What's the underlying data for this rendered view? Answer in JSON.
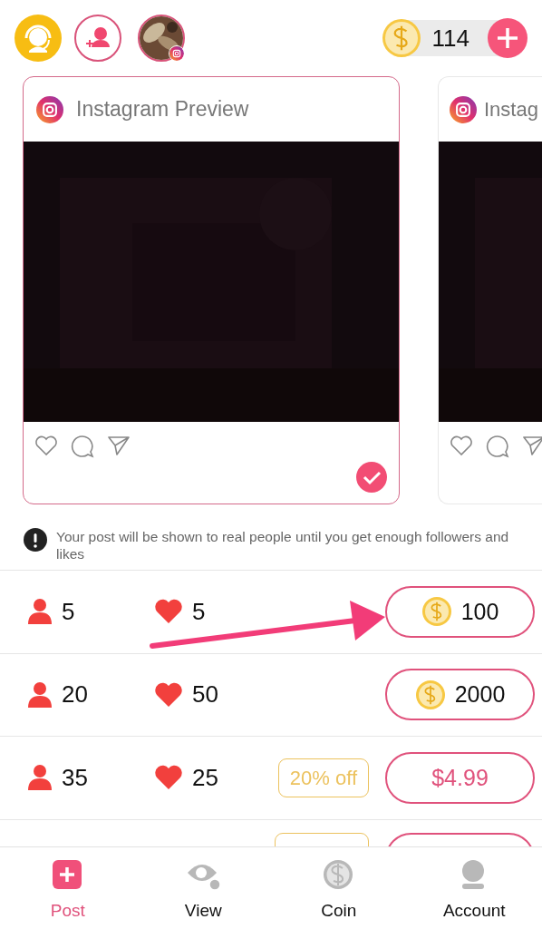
{
  "top_bar": {
    "coins": "114"
  },
  "previews": [
    {
      "title": "Instagram Preview",
      "selected": true
    },
    {
      "title": "Instag",
      "selected": false
    }
  ],
  "notice": "Your post will be shown to real people until you get enough followers and likes",
  "packages": [
    {
      "kind": "full",
      "followers": "5",
      "likes": "5",
      "price": {
        "kind": "coin",
        "text": "100"
      }
    },
    {
      "kind": "full",
      "followers": "20",
      "likes": "50",
      "price": {
        "kind": "coin",
        "text": "2000"
      }
    },
    {
      "kind": "full",
      "followers": "35",
      "likes": "25",
      "discount": "20% off",
      "price": {
        "kind": "money",
        "text": "$4.99"
      }
    },
    {
      "kind": "peek"
    }
  ],
  "nav": [
    {
      "label": "Post",
      "kind": "post",
      "selected": true
    },
    {
      "label": "View",
      "kind": "view",
      "selected": false
    },
    {
      "label": "Coin",
      "kind": "coin",
      "selected": false
    },
    {
      "label": "Account",
      "kind": "account",
      "selected": false
    }
  ]
}
